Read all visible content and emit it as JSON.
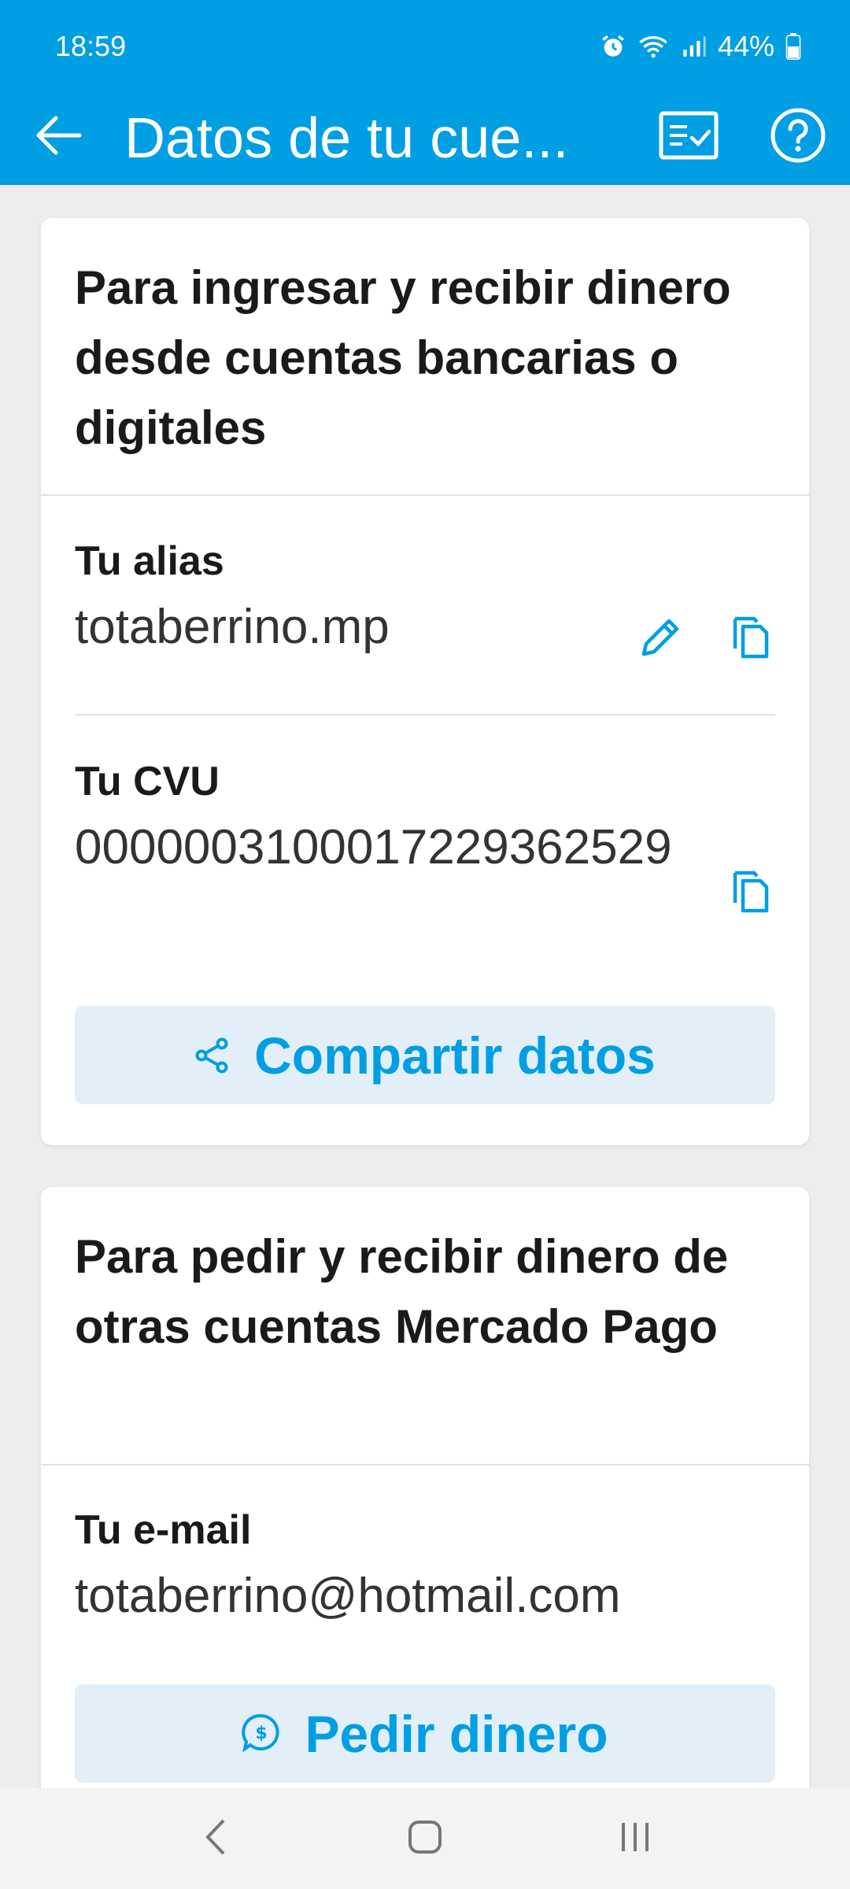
{
  "status_bar": {
    "time": "18:59",
    "battery": "44%",
    "icons": [
      "alarm-icon",
      "wifi-icon",
      "signal-icon",
      "battery-icon"
    ]
  },
  "toolbar": {
    "title": "Datos de tu cue...",
    "back_icon": "arrow-left-icon",
    "receipt_icon": "checklist-icon",
    "help_icon": "help-circle-icon"
  },
  "card_bank": {
    "heading": "Para ingresar y recibir dinero desde cuentas bancarias o digitales",
    "alias_label": "Tu alias",
    "alias_value": "totaberrino.mp",
    "cvu_label": "Tu CVU",
    "cvu_value": "0000003100017229362529",
    "share_button": "Compartir datos"
  },
  "card_mp": {
    "heading": "Para pedir y recibir dinero de otras cuentas Mercado Pago",
    "email_label": "Tu e-mail",
    "email_value": "totaberrino@hotmail.com",
    "request_button": "Pedir dinero"
  },
  "colors": {
    "brand": "#009ee3",
    "button_bg": "#e3eff8",
    "background": "#ededed"
  }
}
